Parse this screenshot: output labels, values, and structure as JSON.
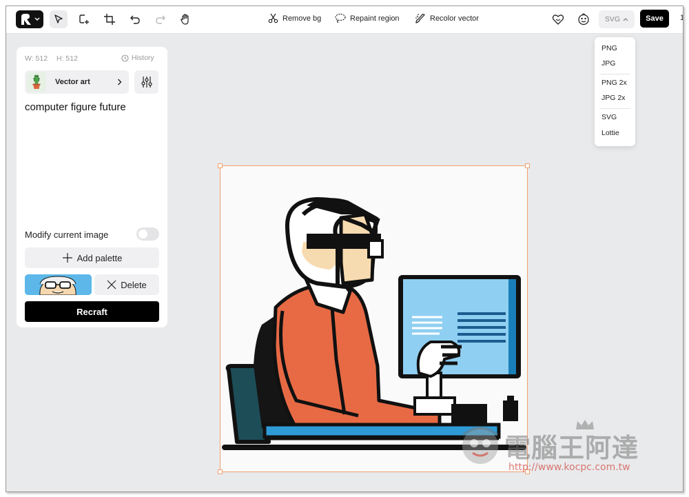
{
  "toolbar": {
    "remove_bg": "Remove bg",
    "repaint_region": "Repaint region",
    "recolor_vector": "Recolor vector",
    "format_value": "SVG",
    "save_label": "Save",
    "cut_off_label": "1"
  },
  "export_menu": {
    "items": [
      "PNG",
      "JPG",
      "PNG 2x",
      "JPG 2x",
      "SVG",
      "Lottie"
    ]
  },
  "panel": {
    "width_label": "W: 512",
    "height_label": "H: 512",
    "history_label": "History",
    "style_label": "Vector art",
    "prompt": "computer figure future",
    "modify_label": "Modify current image",
    "modify_enabled": false,
    "add_palette_label": "Add palette",
    "delete_label": "Delete",
    "recraft_label": "Recraft"
  },
  "colors": {
    "accent": "#000000",
    "selection": "#f1a070",
    "palette_swatch": "#5db8e9",
    "figure_jacket": "#e76a45",
    "monitor_screen": "#8fcff2"
  },
  "watermark": {
    "title": "電腦王阿達",
    "url": "http://www.kocpc.com.tw"
  }
}
